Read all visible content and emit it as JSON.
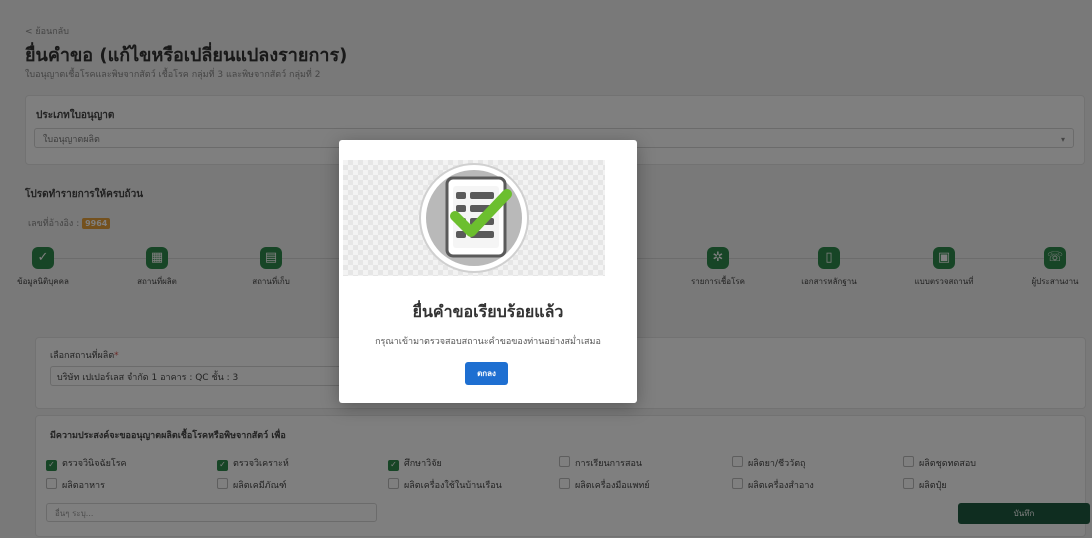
{
  "header": {
    "back_label": "< ย้อนกลับ",
    "title": "ยื่นคำขอ (แก้ไขหรือเปลี่ยนแปลงรายการ)",
    "subtitle": "ใบอนุญาตเชื้อโรคและพิษจากสัตว์ เชื้อโรค กลุ่มที่ 3 และพิษจากสัตว์ กลุ่มที่ 2"
  },
  "license_type": {
    "label": "ประเภทใบอนุญาต",
    "value": "ใบอนุญาตผลิต"
  },
  "steps_section": {
    "title": "โปรดทำรายการให้ครบถ้วน",
    "ref_label": "เลขที่อ้างอิง :",
    "ref_value": "9964",
    "steps": [
      {
        "label": "ข้อมูลนิติบุคคล",
        "icon": "check-icon",
        "glyph": "✓"
      },
      {
        "label": "สถานที่ผลิต",
        "icon": "building-icon",
        "glyph": "▦"
      },
      {
        "label": "สถานที่เก็บ",
        "icon": "warehouse-icon",
        "glyph": "▤"
      },
      {
        "label": "รายการเชื้อโรค",
        "icon": "gears-icon",
        "glyph": "✲"
      },
      {
        "label": "เอกสารหลักฐาน",
        "icon": "document-icon",
        "glyph": "▯"
      },
      {
        "label": "แบบตรวจสถานที่",
        "icon": "clipboard-icon",
        "glyph": "▣"
      },
      {
        "label": "ผู้ประสานงาน",
        "icon": "phone-icon",
        "glyph": "☏"
      }
    ]
  },
  "facility": {
    "label": "เลือกสถานที่ผลิต",
    "required_mark": "*",
    "value": "บริษัท เปเปอร์เลส จำกัด 1 อาคาร : QC ชั้น : 3"
  },
  "purpose": {
    "label": "มีความประสงค์จะขออนุญาตผลิตเชื้อโรคหรือพิษจากสัตว์ เพื่อ",
    "options": [
      {
        "label": "ตรวจวินิจฉัยโรค",
        "checked": true
      },
      {
        "label": "ตรวจวิเคราะห์",
        "checked": true
      },
      {
        "label": "ศึกษาวิจัย",
        "checked": true
      },
      {
        "label": "การเรียนการสอน",
        "checked": false
      },
      {
        "label": "ผลิตยา/ชีววัตถุ",
        "checked": false
      },
      {
        "label": "ผลิตชุดทดสอบ",
        "checked": false
      },
      {
        "label": "ผลิตอาหาร",
        "checked": false
      },
      {
        "label": "ผลิตเคมีภัณฑ์",
        "checked": false
      },
      {
        "label": "ผลิตเครื่องใช้ในบ้านเรือน",
        "checked": false
      },
      {
        "label": "ผลิตเครื่องมือแพทย์",
        "checked": false
      },
      {
        "label": "ผลิตเครื่องสำอาง",
        "checked": false
      },
      {
        "label": "ผลิตปุ๋ย",
        "checked": false
      }
    ],
    "other_placeholder": "อื่นๆ ระบุ...",
    "save_label": "บันทึก"
  },
  "modal": {
    "title": "ยื่นคำขอเรียบร้อยแล้ว",
    "message": "กรุณาเข้ามาตรวจสอบสถานะคำขอของท่านอย่างสม่ำเสมอ",
    "ok_label": "ตกลง"
  },
  "colors": {
    "primary_green": "#2f8a4c",
    "dark_green": "#1f5a40",
    "badge_orange": "#e8a33d",
    "ok_blue": "#1e6fd1"
  }
}
